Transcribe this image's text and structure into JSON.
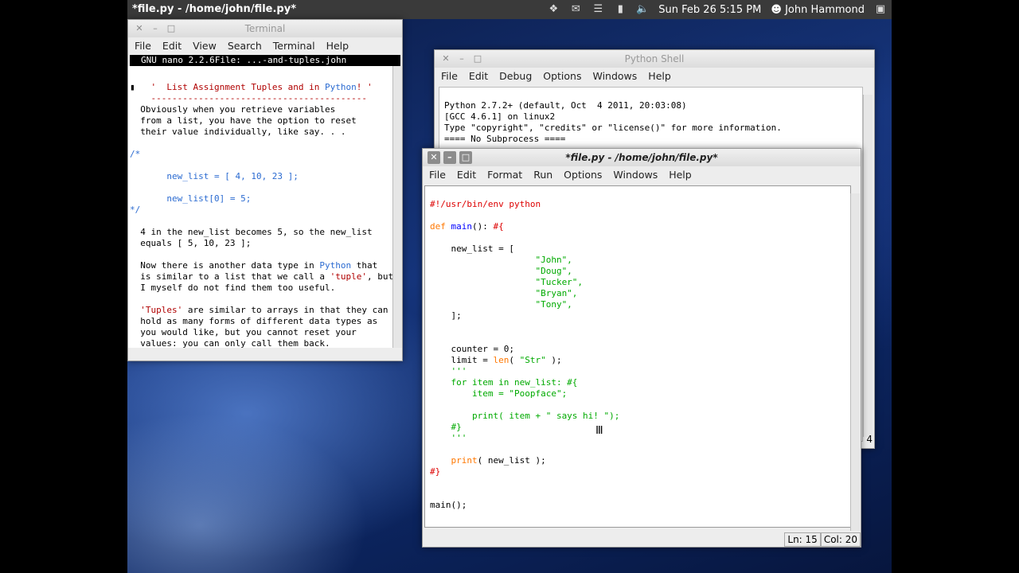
{
  "topbar": {
    "app_title": "*file.py - /home/john/file.py*",
    "datetime": "Sun Feb 26  5:15 PM",
    "user": "John Hammond"
  },
  "terminal": {
    "title": "Terminal",
    "menu": [
      "File",
      "Edit",
      "View",
      "Search",
      "Terminal",
      "Help"
    ],
    "nano_status": "GNU nano 2.2.6File: ...-and-tuples.john",
    "lines": [
      "    '  List Assignment Tuples and in Python! '",
      "    -----------------------------------------",
      "",
      "  Obviously when you retrieve variables",
      "  from a list, you have the option to reset",
      "  their value individually, like say. . .",
      "",
      "/*",
      "       new_list = [ 4, 10, 23 ];",
      "",
      "       new_list[0] = 5;",
      "*/",
      "",
      "  4 in the new_list becomes 5, so the new_list",
      "  equals [ 5, 10, 23 ];",
      "",
      "  Now there is another data type in Python that",
      "  is similar to a list that we call a 'tuple', but",
      "  I myself do not find them too useful.",
      "",
      "  'Tuples' are similar to arrays in that they can",
      "  hold as many forms of different data types as",
      "  you would like, but you cannot reset your",
      "  values: you can only call them back."
    ]
  },
  "shell": {
    "title": "Python Shell",
    "menu": [
      "File",
      "Edit",
      "Debug",
      "Options",
      "Windows",
      "Help"
    ],
    "lines": [
      "Python 2.7.2+ (default, Oct  4 2011, 20:03:08)",
      "[GCC 4.6.1] on linux2",
      "Type \"copyright\", \"credits\" or \"license()\" for more information.",
      "==== No Subprocess ====",
      ">>>"
    ],
    "side_number": "4"
  },
  "editor": {
    "title": "*file.py - /home/john/file.py*",
    "menu": [
      "File",
      "Edit",
      "Format",
      "Run",
      "Options",
      "Windows",
      "Help"
    ],
    "status": {
      "ln": "Ln: 15",
      "col": "Col: 20"
    }
  }
}
